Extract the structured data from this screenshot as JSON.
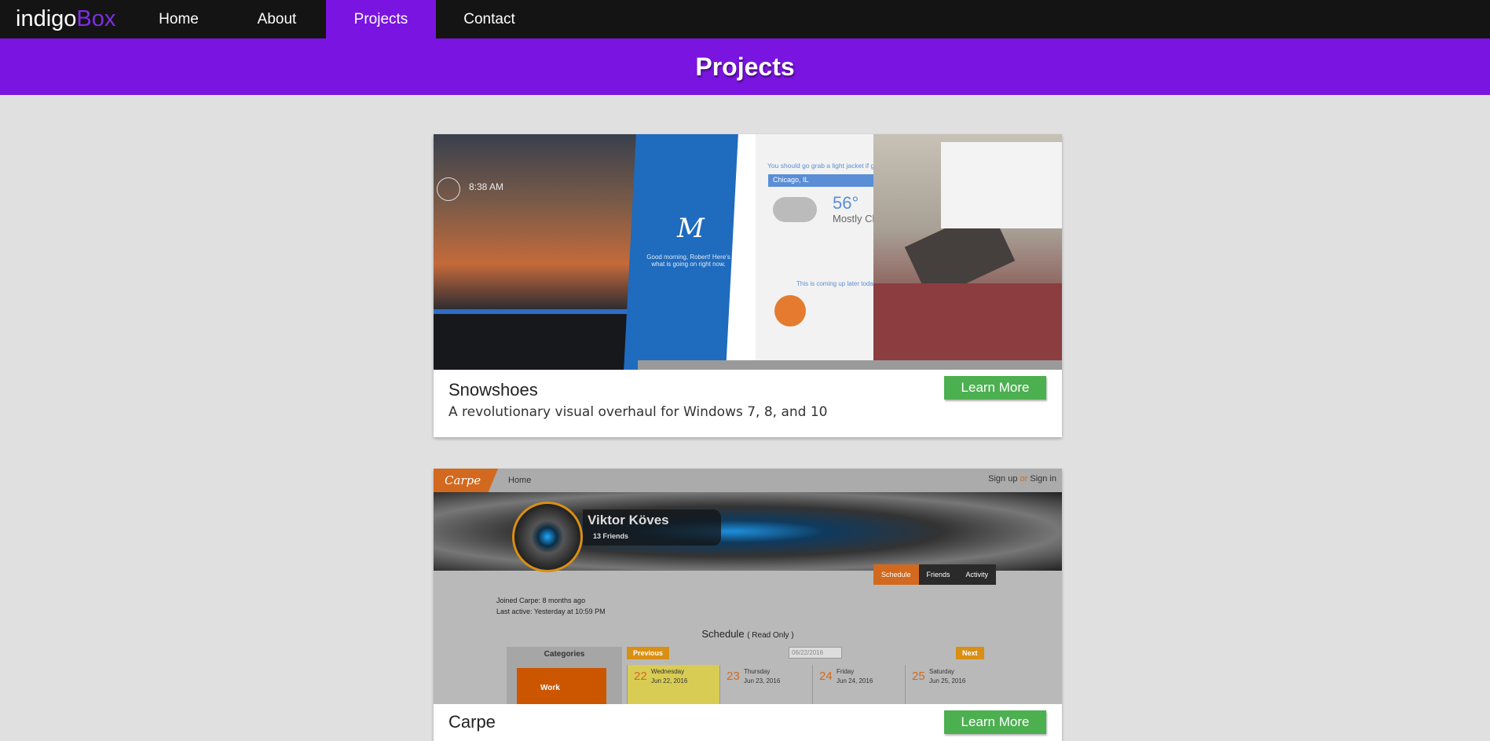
{
  "nav": {
    "logo_a": "indigo",
    "logo_b": "Box",
    "links": [
      "Home",
      "About",
      "Projects",
      "Contact"
    ],
    "active": "Projects"
  },
  "banner": {
    "title": "Projects"
  },
  "colors": {
    "accent": "#7a14e0",
    "nav_bg": "#141414",
    "button": "#4caf50",
    "page_bg": "#e0e0e0"
  },
  "projects": [
    {
      "title": "Snowshoes",
      "description": "A revolutionary visual overhaul for Windows 7, 8, and 10",
      "button": "Learn More",
      "screenshot": {
        "time": "8:38 AM",
        "greeting": "Good morning, Robert! Here's what is going on right now.",
        "weather_tip": "You should go grab a light jacket if going",
        "city": "Chicago, IL",
        "temp": "56°",
        "condition": "Mostly Clo",
        "later": "This is coming up later today"
      }
    },
    {
      "title": "Carpe",
      "description": "",
      "button": "Learn More",
      "screenshot": {
        "logo": "Carpe",
        "home": "Home",
        "sign_up": "Sign up",
        "or": "or",
        "sign_in": "Sign in",
        "user_name": "Viktor Köves",
        "friends": "13 Friends",
        "tabs": [
          "Schedule",
          "Friends",
          "Activity"
        ],
        "joined": "Joined Carpe: 8 months ago",
        "last_active": "Last active: Yesterday at 10:59 PM",
        "schedule": "Schedule",
        "read_only": "( Read Only )",
        "categories": "Categories",
        "category_work": "Work",
        "previous": "Previous",
        "next": "Next",
        "date_input": "06/22/2016",
        "days": [
          {
            "num": "22",
            "weekday": "Wednesday",
            "date": "Jun 22, 2016"
          },
          {
            "num": "23",
            "weekday": "Thursday",
            "date": "Jun 23, 2016"
          },
          {
            "num": "24",
            "weekday": "Friday",
            "date": "Jun 24, 2016"
          },
          {
            "num": "25",
            "weekday": "Saturday",
            "date": "Jun 25, 2016"
          }
        ]
      }
    }
  ]
}
